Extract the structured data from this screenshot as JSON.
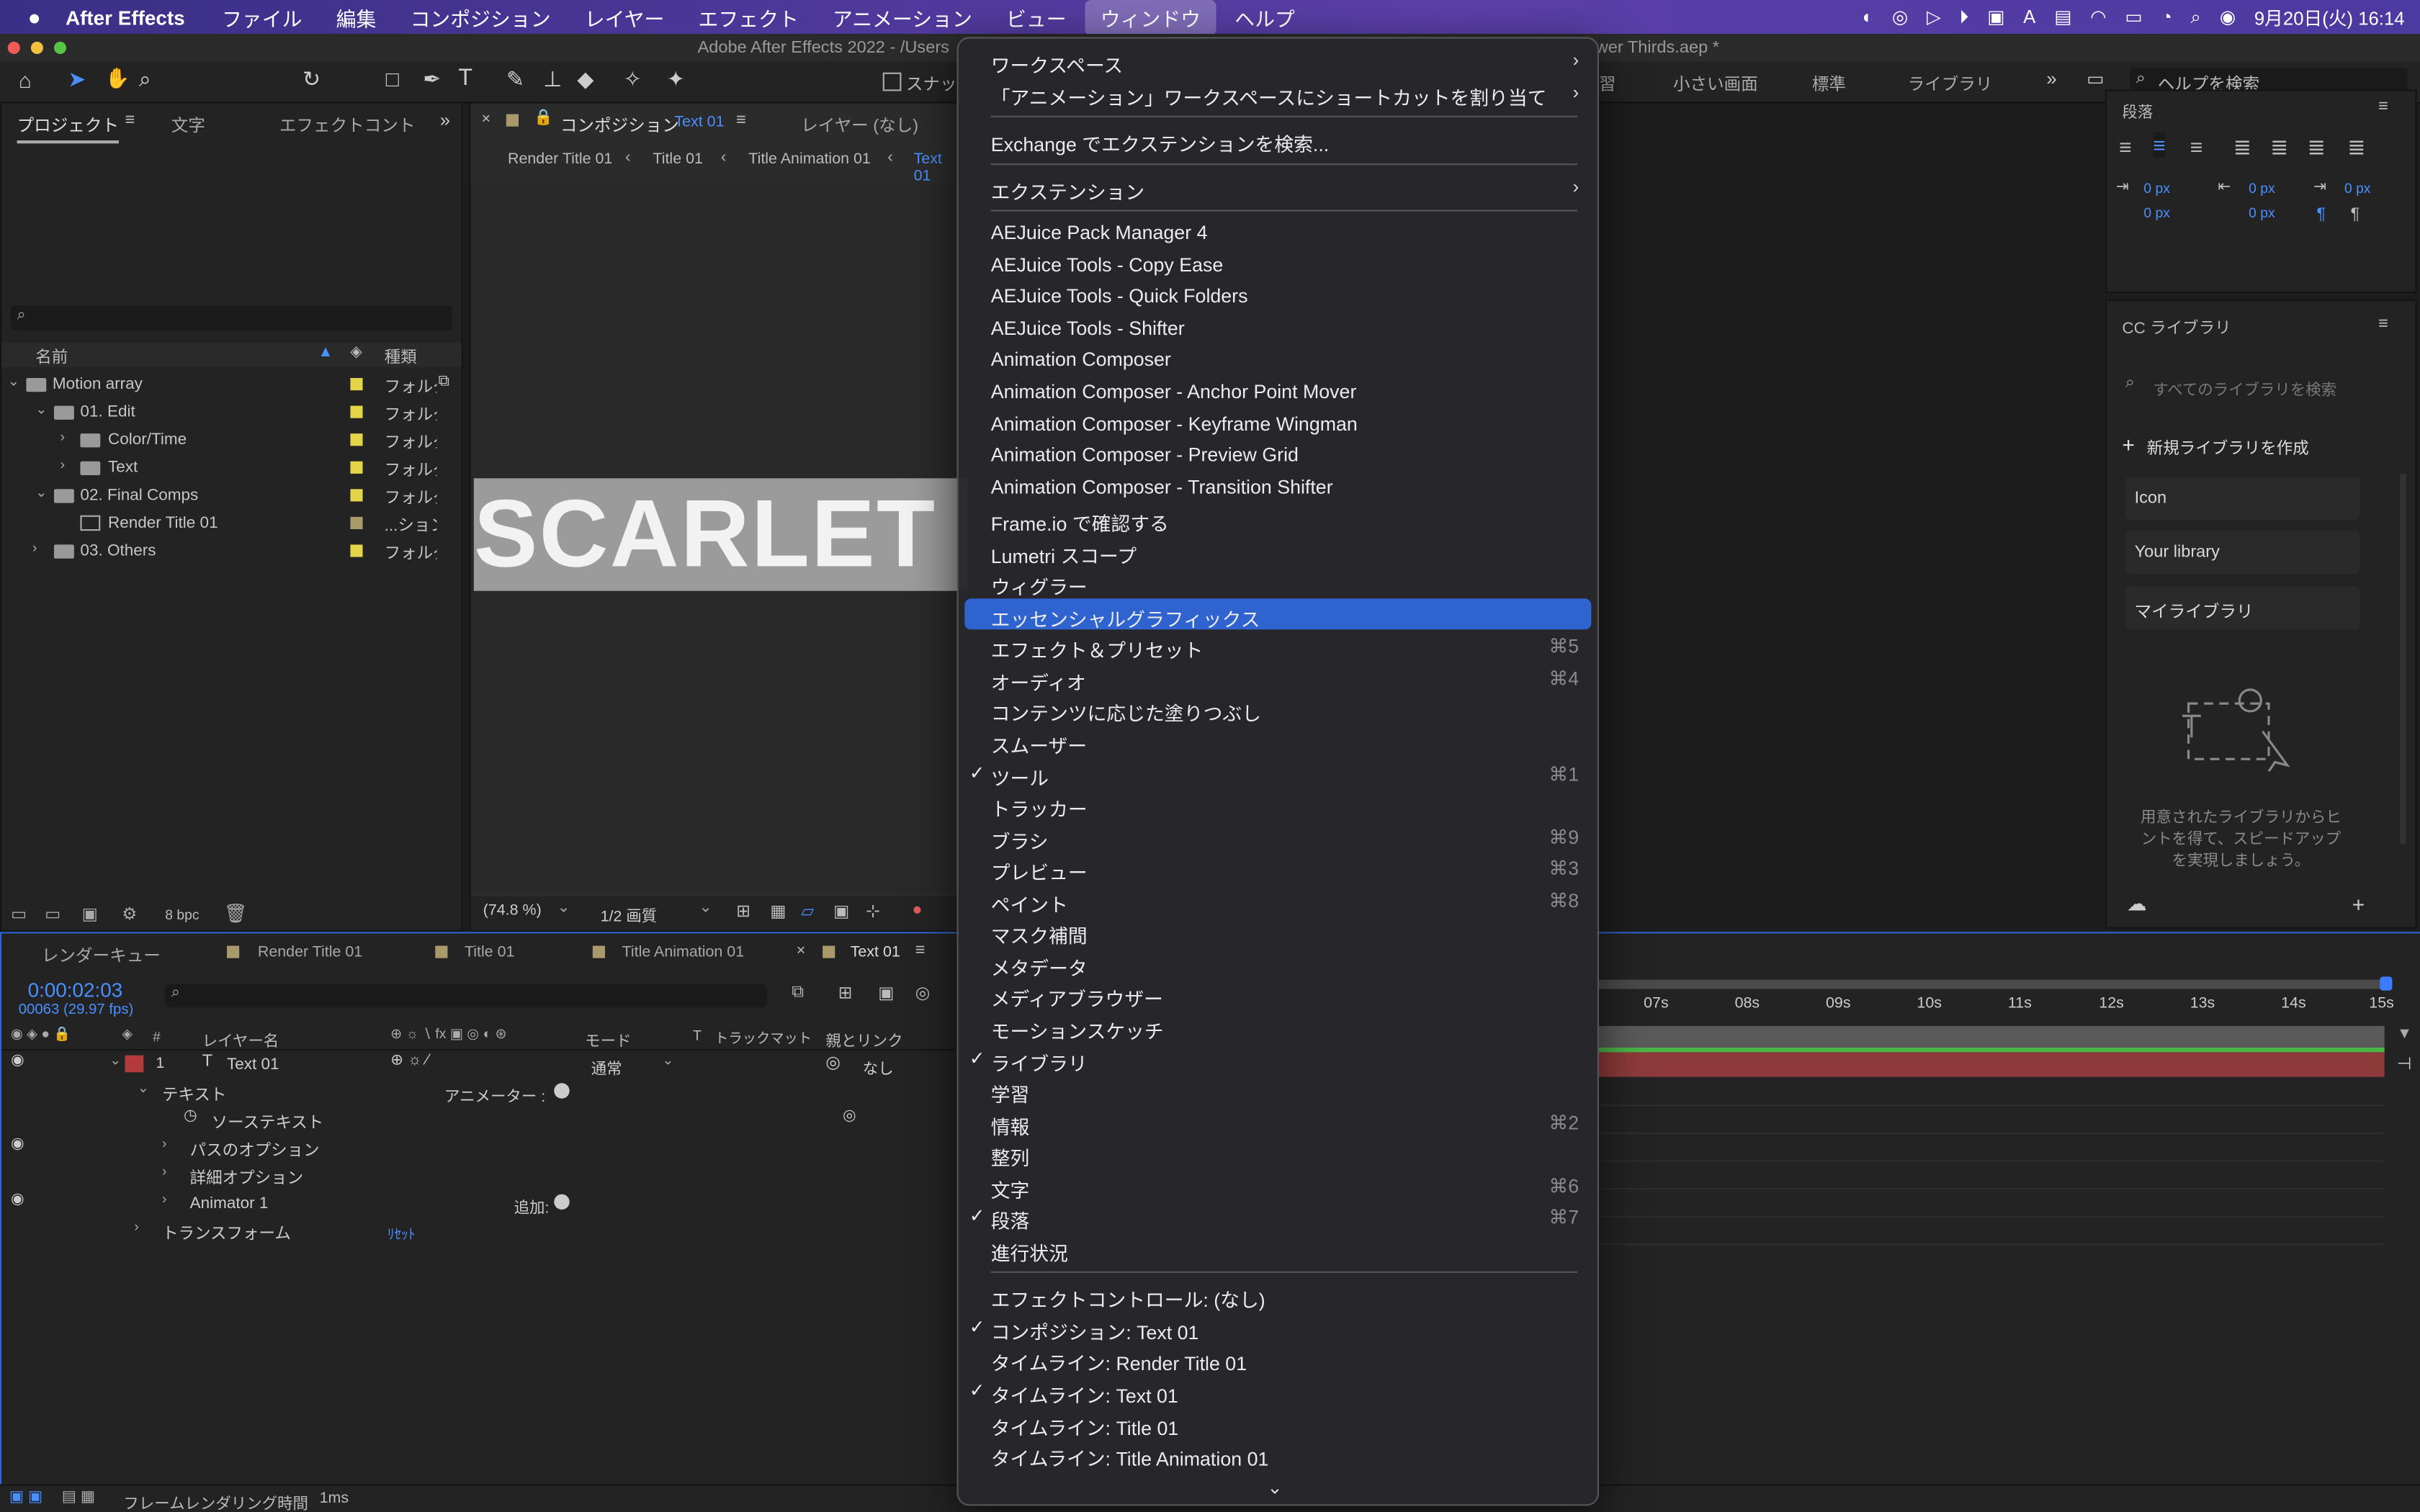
{
  "menubar": {
    "app_name": "After Effects",
    "items": [
      "ファイル",
      "編集",
      "コンポジション",
      "レイヤー",
      "エフェクト",
      "アニメーション",
      "ビュー",
      "ウィンドウ",
      "ヘルプ"
    ],
    "active_item": "ウィンドウ",
    "clock": "9月20日(火)  16:14"
  },
  "titlebar": {
    "left": "Adobe After Effects 2022 - /Users",
    "right": "wer Thirds.aep *"
  },
  "toolbar": {
    "snap_label": "スナッ",
    "workspaces": [
      "習",
      "小さい画面",
      "標準",
      "ライブラリ"
    ],
    "help_search_placeholder": "ヘルプを検索"
  },
  "project_panel": {
    "tabs": [
      "プロジェクト",
      "文字",
      "エフェクトコント"
    ],
    "search_placeholder": "",
    "col_name": "名前",
    "col_type": "種類",
    "rows": [
      {
        "name": "Motion array",
        "type": "フォルダ"
      },
      {
        "name": "01. Edit",
        "type": "フォルダ"
      },
      {
        "name": "Color/Time",
        "type": "フォルダ"
      },
      {
        "name": "Text",
        "type": "フォルダ"
      },
      {
        "name": "02. Final Comps",
        "type": "フォルダ"
      },
      {
        "name": "Render Title 01",
        "type": "...ション"
      },
      {
        "name": "03. Others",
        "type": "フォルダ"
      }
    ],
    "bpc": "8 bpc"
  },
  "comp_panel": {
    "tab_label": "コンポジション",
    "tab_comp": "Text 01",
    "layer_tab": "レイヤー (なし)",
    "breadcrumbs": [
      "Render Title 01",
      "Title 01",
      "Title Animation 01",
      "Text 01"
    ],
    "canvas_text": "SCARLET",
    "zoom": "(74.8 %)",
    "resolution": "1/2 画質"
  },
  "paragraph_panel": {
    "title": "段落",
    "indent_values": [
      "0 px",
      "0 px",
      "0 px",
      "0 px",
      "0 px"
    ]
  },
  "library_panel": {
    "title": "CC ライブラリ",
    "search_placeholder": "すべてのライブラリを検索",
    "new_library": "新規ライブラリを作成",
    "libraries": [
      "Icon",
      "Your library",
      "マイライブラリ"
    ],
    "hint": "用意されたライブラリからヒントを得て、スピードアップを実現しましょう。"
  },
  "timeline": {
    "tabs": [
      "レンダーキュー",
      "Render Title 01",
      "Title 01",
      "Title Animation 01",
      "Text 01"
    ],
    "timecode": "0:00:02:03",
    "frame_info": "00063 (29.97 fps)",
    "col_headers": [
      "#",
      "レイヤー名",
      "モード",
      "T",
      "トラックマット",
      "親とリンク"
    ],
    "layer_num": "1",
    "layer_name": "Text 01",
    "mode": "通常",
    "parent": "なし",
    "props": [
      "テキスト",
      "ソーステキスト",
      "パスのオプション",
      "詳細オプション",
      "Animator 1",
      "トランスフォーム"
    ],
    "animator_label": "アニメーター :",
    "add_label": "追加:",
    "reset_label": "ﾘｾｯﾄ",
    "ruler": [
      "07s",
      "08s",
      "09s",
      "10s",
      "11s",
      "12s",
      "13s",
      "14s",
      "15s"
    ],
    "footer": "フレームレンダリング時間",
    "footer_value": "1ms"
  },
  "window_menu": {
    "items": [
      {
        "label": "ワークスペース",
        "submenu": true
      },
      {
        "label": "「アニメーション」ワークスペースにショートカットを割り当て",
        "submenu": true
      },
      {
        "label": "Exchange でエクステンションを検索..."
      },
      {
        "label": "エクステンション",
        "submenu": true
      },
      {
        "label": "AEJuice Pack Manager 4"
      },
      {
        "label": "AEJuice Tools - Copy Ease"
      },
      {
        "label": "AEJuice Tools - Quick Folders"
      },
      {
        "label": "AEJuice Tools - Shifter"
      },
      {
        "label": "Animation Composer"
      },
      {
        "label": "Animation Composer - Anchor Point Mover"
      },
      {
        "label": "Animation Composer - Keyframe Wingman"
      },
      {
        "label": "Animation Composer - Preview Grid"
      },
      {
        "label": "Animation Composer - Transition Shifter"
      },
      {
        "label": "Frame.io で確認する"
      },
      {
        "label": "Lumetri スコープ"
      },
      {
        "label": "ウィグラー"
      },
      {
        "label": "エッセンシャルグラフィックス",
        "highlighted": true
      },
      {
        "label": "エフェクト＆プリセット",
        "shortcut": "⌘5"
      },
      {
        "label": "オーディオ",
        "shortcut": "⌘4"
      },
      {
        "label": "コンテンツに応じた塗りつぶし"
      },
      {
        "label": "スムーザー"
      },
      {
        "label": "ツール",
        "shortcut": "⌘1",
        "checked": true
      },
      {
        "label": "トラッカー"
      },
      {
        "label": "ブラシ",
        "shortcut": "⌘9"
      },
      {
        "label": "プレビュー",
        "shortcut": "⌘3"
      },
      {
        "label": "ペイント",
        "shortcut": "⌘8"
      },
      {
        "label": "マスク補間"
      },
      {
        "label": "メタデータ"
      },
      {
        "label": "メディアブラウザー"
      },
      {
        "label": "モーションスケッチ"
      },
      {
        "label": "ライブラリ",
        "checked": true
      },
      {
        "label": "学習"
      },
      {
        "label": "情報",
        "shortcut": "⌘2"
      },
      {
        "label": "整列"
      },
      {
        "label": "文字",
        "shortcut": "⌘6"
      },
      {
        "label": "段落",
        "shortcut": "⌘7",
        "checked": true
      },
      {
        "label": "進行状況"
      },
      {
        "label": "エフェクトコントロール: (なし)"
      },
      {
        "label": "コンポジション: Text 01",
        "checked": true
      },
      {
        "label": "タイムライン: Render Title 01"
      },
      {
        "label": "タイムライン: Text 01",
        "checked": true
      },
      {
        "label": "タイムライン: Title 01"
      },
      {
        "label": "タイムライン: Title Animation 01"
      }
    ]
  },
  "colors": {
    "accent": "#2f63d0",
    "menubar": "#4b3aa0",
    "layer_red": "#8e3a3a",
    "label_yellow": "#e4d44a"
  }
}
